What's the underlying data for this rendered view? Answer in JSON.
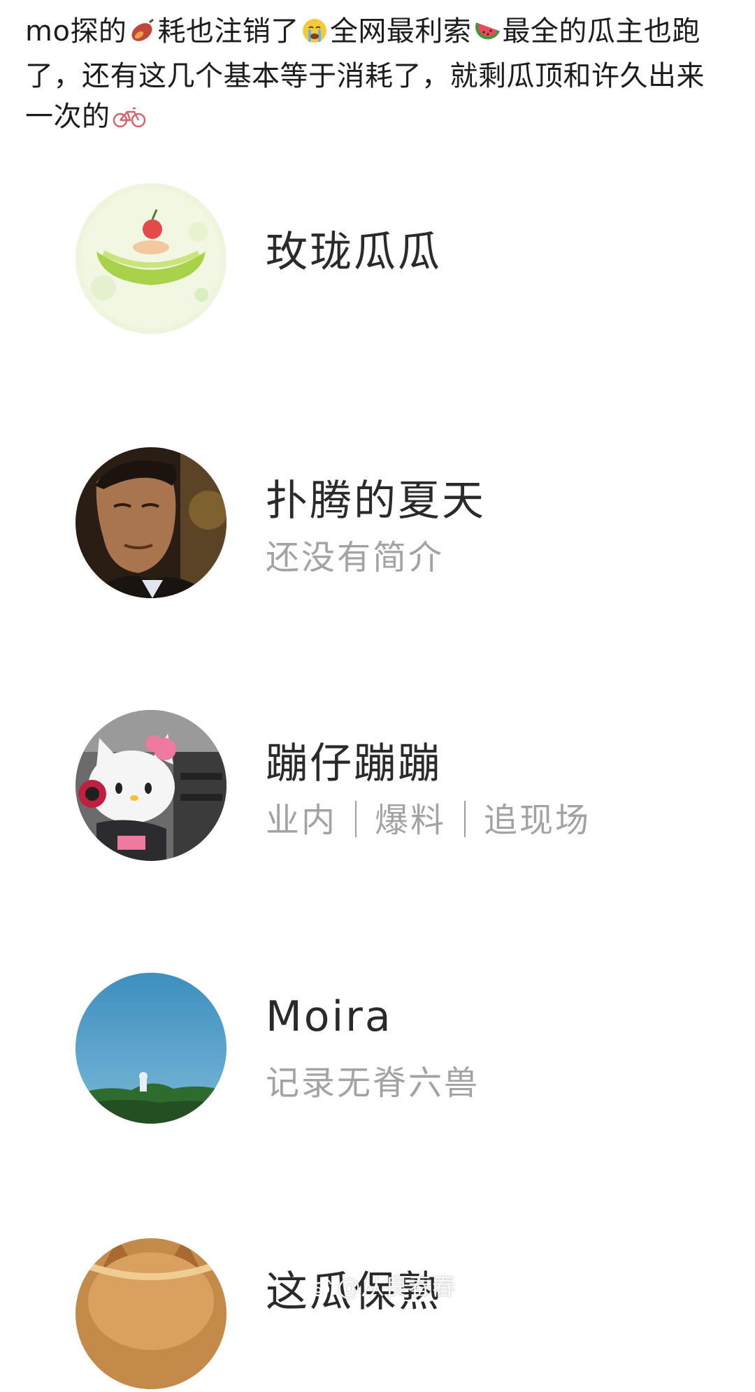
{
  "post": {
    "seg1": "mo探的",
    "seg2": "耗也注销了",
    "seg3": "全网最利索",
    "seg4": "最全的瓜主也跑了，还有这几个基本等于消耗了，就剩瓜顶和许久出来一次的",
    "emoji1": "sweet-potato-icon",
    "emoji2": "crying-face-icon",
    "emoji3": "watermelon-icon",
    "emoji4": "bicycle-icon"
  },
  "accounts": [
    {
      "name": "玫珑瓜瓜",
      "bio": "",
      "avatar": "melon-avatar"
    },
    {
      "name": "扑腾的夏天",
      "bio": "还没有简介",
      "avatar": "man-portrait-avatar"
    },
    {
      "name": "蹦仔蹦蹦",
      "bio_parts": [
        "业内",
        "爆料",
        "追现场"
      ],
      "avatar": "hello-kitty-avatar"
    },
    {
      "name": "Moira",
      "bio": "记录无脊六兽",
      "avatar": "sky-landscape-avatar"
    },
    {
      "name": "这瓜保熟",
      "bio": "",
      "avatar": "cat-avatar"
    }
  ],
  "watermark": {
    "text": "@从良春春",
    "icon": "weibo-icon"
  },
  "colors": {
    "name": "#2a2a2a",
    "bio": "#a3a3a3",
    "text": "#1c1c1c"
  }
}
